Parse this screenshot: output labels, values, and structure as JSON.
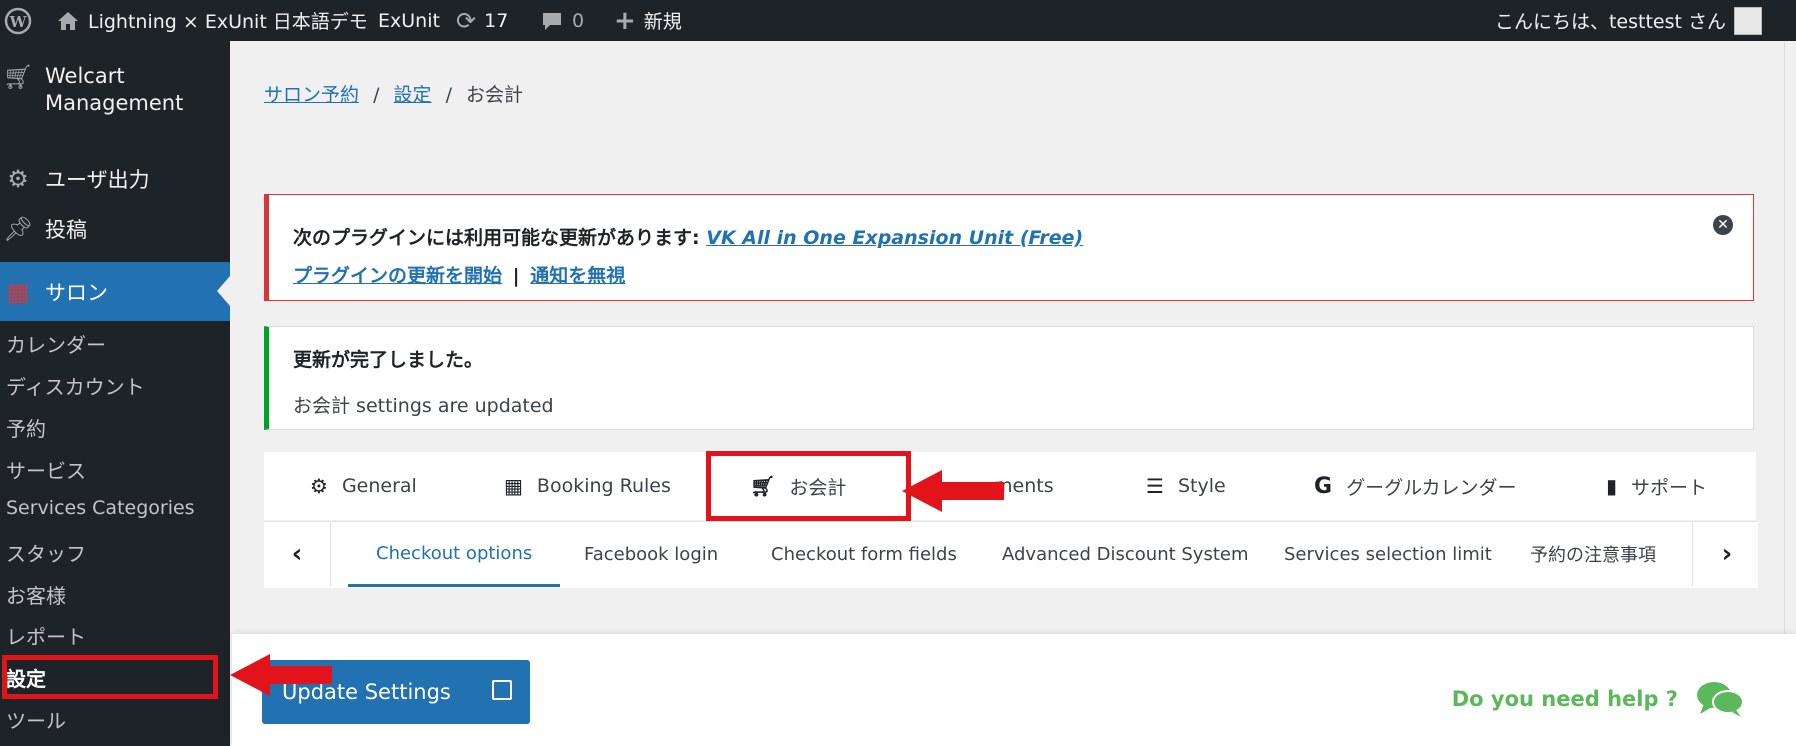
{
  "admin_bar": {
    "site_name": "Lightning × ExUnit 日本語デモ",
    "exunit": "ExUnit",
    "updates_count": "17",
    "comments_count": "0",
    "new_label": "新規",
    "greeting": "こんにちは、testtest さん"
  },
  "sidebar": {
    "welcart": "Welcart Management",
    "user_export": "ユーザ出力",
    "posts": "投稿",
    "salon": "サロン",
    "submenu": [
      "カレンダー",
      "ディスカウント",
      "予約",
      "サービス",
      "Services Categories",
      "スタッフ",
      "お客様",
      "レポート",
      "設定",
      "ツール"
    ]
  },
  "breadcrumb": {
    "salon": "サロン予約",
    "settings": "設定",
    "sep": "/",
    "current": "お会計"
  },
  "notice_error": {
    "text": "次のプラグインには利用可能な更新があります:",
    "plugin_link": "VK All in One Expansion Unit (Free)",
    "start_update": "プラグインの更新を開始",
    "divider": "|",
    "dismiss_notice": "通知を無視"
  },
  "notice_success": {
    "title": "更新が完了しました。",
    "message": "お会計 settings are updated"
  },
  "tabs": [
    "General",
    "Booking Rules",
    "お会計",
    "ments",
    "Style",
    "グーグルカレンダー",
    "サポート"
  ],
  "subtabs": [
    "Checkout options",
    "Facebook login",
    "Checkout form fields",
    "Advanced Discount System",
    "Services selection limit",
    "予約の注意事項"
  ],
  "update_button": "Update Settings",
  "help_text": "Do you need help ?",
  "colors": {
    "accent": "#2271b1",
    "admin_dark": "#1d2327",
    "annotation_red": "#e3131b",
    "success": "#00a32a",
    "error": "#d63638",
    "help_green": "#5cb85c"
  }
}
